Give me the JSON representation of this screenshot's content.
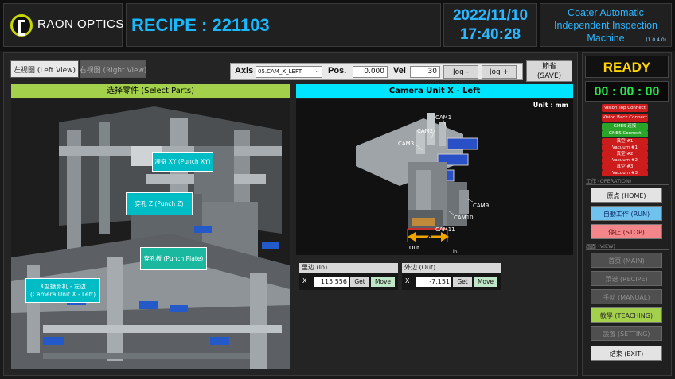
{
  "header": {
    "logo_text": "RAON OPTICS",
    "recipe": "RECIPE : 221103",
    "date": "2022/11/10",
    "time": "17:40:28",
    "app_title_line1": "Coater Automatic",
    "app_title_line2": "Independent Inspection",
    "app_title_line3": "Machine",
    "version": "(1.0.4.0)"
  },
  "tabs": {
    "left": "左视图 (Left View)",
    "right": "右视图 (Right View)"
  },
  "axis_bar": {
    "axis_label": "Axis",
    "axis_value": "05.CAM_X_LEFT",
    "pos_label": "Pos.",
    "pos_value": "0.000",
    "vel_label": "Vel",
    "vel_value": "30",
    "jog_minus": "Jog -",
    "jog_plus": "Jog +",
    "save_line1": "節省",
    "save_line2": "(SAVE)"
  },
  "select_parts": {
    "header": "选择零件 (Select Parts)",
    "tags": {
      "punch_xy": "凑奇 XY (Punch XY)",
      "punch_z": "穿孔 Z (Punch Z)",
      "punch_plate": "穿孔板 (Punch Plate)",
      "camera_unit_line1": "X型摄影机 - 左边",
      "camera_unit_line2": "(Camera Unit X - Left)"
    }
  },
  "camera_unit": {
    "header": "Camera Unit X - Left",
    "unit": "Unit : mm",
    "labels": [
      "CAM1",
      "CAM2",
      "CAM3",
      "CAM9",
      "CAM10",
      "CAM11"
    ],
    "out_label": "Out",
    "in_label": "In",
    "x_label": "X"
  },
  "positions": {
    "in": {
      "title": "里边 (In)",
      "axis": "X",
      "value": "115.556",
      "get": "Get",
      "move": "Move"
    },
    "out": {
      "title": "外边 (Out)",
      "axis": "X",
      "value": "-7.151",
      "get": "Get",
      "move": "Move"
    }
  },
  "right_panel": {
    "status": "READY",
    "timer": "00 : 00 : 00",
    "indicators": [
      {
        "label": "Vision Top Connect",
        "color": "red"
      },
      {
        "label": "Vision Back Connect",
        "color": "red"
      },
      {
        "label": "GMES 连接",
        "color": "green"
      },
      {
        "label": "GMES Connect",
        "color": "green"
      },
      {
        "label": "真空 #1",
        "color": "red"
      },
      {
        "label": "Vacuum #1",
        "color": "red"
      },
      {
        "label": "真空 #2",
        "color": "red"
      },
      {
        "label": "Vacuum #2",
        "color": "red"
      },
      {
        "label": "真空 #3",
        "color": "red"
      },
      {
        "label": "Vacuum #3",
        "color": "red"
      }
    ],
    "operation_section": "工作 (OPERATION)",
    "home": "原点 (HOME)",
    "run": "自動工作 (RUN)",
    "stop": "停止 (STOP)",
    "view_section": "画面 (VIEW)",
    "main": "首页 (MAIN)",
    "recipe": "菜谱 (RECIPE)",
    "manual": "手动 (MANUAL)",
    "teaching": "教學 (TEACHING)",
    "setting": "設置 (SETTING)",
    "exit": "结束 (EXIT)"
  },
  "colors": {
    "accent_blue": "#18b9ff",
    "ready_yellow": "#ffd400",
    "timer_green": "#26e84a",
    "select_green": "#a4d14c",
    "cam_cyan": "#00e5ff"
  }
}
